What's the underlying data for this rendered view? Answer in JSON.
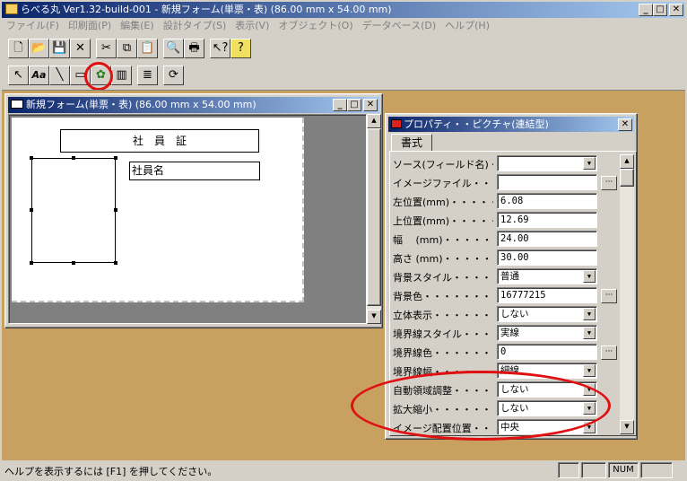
{
  "app": {
    "title": "らべる丸 Ver1.32-build-001 - 新規フォーム(単票・表) (86.00 mm x 54.00 mm)"
  },
  "menu": [
    "ファイル(F)",
    "印刷面(P)",
    "編集(E)",
    "設計タイプ(S)",
    "表示(V)",
    "オブジェクト(O)",
    "データベース(D)",
    "ヘルプ(H)"
  ],
  "toolbar1": [
    {
      "icon": "new-icon",
      "glyph": "🗋"
    },
    {
      "icon": "open-icon",
      "glyph": "📂"
    },
    {
      "icon": "save-icon",
      "glyph": "💾"
    },
    {
      "icon": "close-icon",
      "glyph": "✕"
    },
    {
      "icon": "cut-icon",
      "glyph": "✂"
    },
    {
      "icon": "copy-icon",
      "glyph": "⧉"
    },
    {
      "icon": "paste-icon",
      "glyph": "📋"
    },
    {
      "icon": "print-preview-icon",
      "glyph": "🔍"
    },
    {
      "icon": "print-icon",
      "glyph": "🖶"
    },
    {
      "icon": "whats-this-icon",
      "glyph": "↖?"
    },
    {
      "icon": "help-icon",
      "glyph": "?"
    }
  ],
  "toolbar2": [
    {
      "icon": "pointer-icon",
      "glyph": "↖"
    },
    {
      "icon": "text-tool-icon",
      "glyph": "Aa"
    },
    {
      "icon": "line-tool-icon",
      "glyph": "╲"
    },
    {
      "icon": "rect-tool-icon",
      "glyph": "▭"
    },
    {
      "icon": "picture-tool-icon",
      "glyph": "✿"
    },
    {
      "icon": "barcode-tool-icon",
      "glyph": "▥"
    },
    {
      "icon": "list-tool-icon",
      "glyph": "≣"
    },
    {
      "icon": "refresh-icon",
      "glyph": "⟳"
    }
  ],
  "form_window": {
    "title": "新規フォーム(単票・表) (86.00 mm x 54.00 mm)",
    "label_title": "社　員　証",
    "label_name": "社員名"
  },
  "properties": {
    "title": "プロパティ・・ピクチャ(連結型)",
    "tab": "書式",
    "rows": [
      {
        "label": "ソース(フィールド名)・・・・",
        "value": "",
        "kind": "combo"
      },
      {
        "label": "イメージファイル・・・・・・・",
        "value": "",
        "kind": "ellipsis"
      },
      {
        "label": "左位置(mm)・・・・・・・",
        "value": "6.08",
        "kind": "text"
      },
      {
        "label": "上位置(mm)・・・・・・・",
        "value": "12.69",
        "kind": "text"
      },
      {
        "label": "幅　 (mm)・・・・・・・",
        "value": "24.00",
        "kind": "text"
      },
      {
        "label": "高さ (mm)・・・・・・・",
        "value": "30.00",
        "kind": "text"
      },
      {
        "label": "背景スタイル・・・・・・・",
        "value": "普通",
        "kind": "combo"
      },
      {
        "label": "背景色・・・・・・・・・",
        "value": "16777215",
        "kind": "ellipsis"
      },
      {
        "label": "立体表示・・・・・・・・",
        "value": "しない",
        "kind": "combo"
      },
      {
        "label": "境界線スタイル・・・・・・",
        "value": "実線",
        "kind": "combo"
      },
      {
        "label": "境界線色・・・・・・・・",
        "value": "0",
        "kind": "ellipsis"
      },
      {
        "label": "境界線幅・・・・・・・・",
        "value": "細線",
        "kind": "combo"
      },
      {
        "label": "自動領域調整・・・・・",
        "value": "しない",
        "kind": "combo"
      },
      {
        "label": "拡大縮小・・・・・・・・",
        "value": "しない",
        "kind": "combo"
      },
      {
        "label": "イメージ配置位置・・・",
        "value": "中央",
        "kind": "combo"
      }
    ]
  },
  "status": {
    "help_text": "ヘルプを表示するには [F1] を押してください。",
    "num": "NUM"
  },
  "colors": {
    "mdi_background": "#c8a060",
    "annotation_red": "#e01010"
  }
}
